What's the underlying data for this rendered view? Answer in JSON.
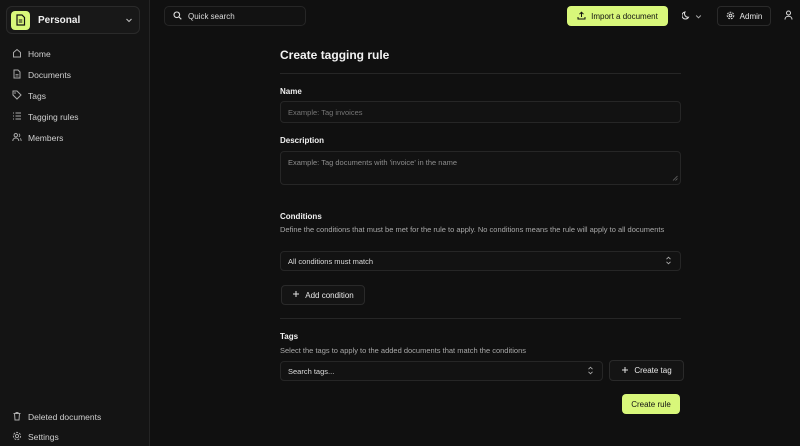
{
  "sidebar": {
    "workspace_name": "Personal",
    "items": [
      {
        "label": "Home",
        "icon": "home-icon"
      },
      {
        "label": "Documents",
        "icon": "document-icon"
      },
      {
        "label": "Tags",
        "icon": "tag-icon"
      },
      {
        "label": "Tagging rules",
        "icon": "list-icon"
      },
      {
        "label": "Members",
        "icon": "users-icon"
      }
    ],
    "bottom_items": [
      {
        "label": "Deleted documents",
        "icon": "trash-icon"
      },
      {
        "label": "Settings",
        "icon": "settings-icon"
      }
    ]
  },
  "topbar": {
    "search_label": "Quick search",
    "import_label": "Import a document",
    "admin_label": "Admin"
  },
  "form": {
    "title": "Create tagging rule",
    "name_label": "Name",
    "name_placeholder": "Example: Tag invoices",
    "description_label": "Description",
    "description_placeholder": "Example: Tag documents with 'invoice' in the name",
    "conditions_label": "Conditions",
    "conditions_help": "Define the conditions that must be met for the rule to apply. No conditions means the rule will apply to all documents",
    "match_select": "All conditions must match",
    "add_condition_label": "Add condition",
    "tags_label": "Tags",
    "tags_help": "Select the tags to apply to the added documents that match the conditions",
    "tags_search_placeholder": "Search tags...",
    "create_tag_label": "Create tag",
    "submit_label": "Create rule"
  },
  "colors": {
    "background": "#101010",
    "sidebar": "#141414",
    "accent": "#d8f77a",
    "border": "#262626"
  }
}
